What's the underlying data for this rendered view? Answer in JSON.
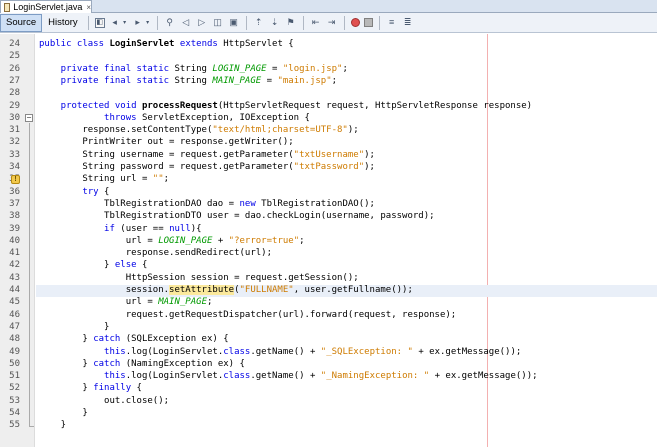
{
  "tab": {
    "filename": "LoginServlet.java",
    "close_glyph": "×"
  },
  "toolbar": {
    "source_label": "Source",
    "history_label": "History"
  },
  "lines": [
    {
      "n": "24",
      "segs": [
        {
          "t": "public class ",
          "c": "kw"
        },
        {
          "t": "LoginServlet ",
          "c": "bold"
        },
        {
          "t": "extends ",
          "c": "kw"
        },
        {
          "t": "HttpServlet {",
          "c": ""
        }
      ]
    },
    {
      "n": "25",
      "segs": []
    },
    {
      "n": "26",
      "segs": [
        {
          "t": "    private final static ",
          "c": "kw"
        },
        {
          "t": "String ",
          "c": ""
        },
        {
          "t": "LOGIN_PAGE",
          "c": "const"
        },
        {
          "t": " = ",
          "c": ""
        },
        {
          "t": "\"login.jsp\"",
          "c": "str"
        },
        {
          "t": ";",
          "c": ""
        }
      ]
    },
    {
      "n": "27",
      "segs": [
        {
          "t": "    private final static ",
          "c": "kw"
        },
        {
          "t": "String ",
          "c": ""
        },
        {
          "t": "MAIN_PAGE",
          "c": "const"
        },
        {
          "t": " = ",
          "c": ""
        },
        {
          "t": "\"main.jsp\"",
          "c": "str"
        },
        {
          "t": ";",
          "c": ""
        }
      ]
    },
    {
      "n": "28",
      "segs": []
    },
    {
      "n": "29",
      "segs": [
        {
          "t": "    protected void ",
          "c": "kw"
        },
        {
          "t": "processRequest",
          "c": "bold"
        },
        {
          "t": "(HttpServletRequest request, HttpServletResponse response)",
          "c": ""
        }
      ]
    },
    {
      "n": "30",
      "segs": [
        {
          "t": "            throws ",
          "c": "kw"
        },
        {
          "t": "ServletException, IOException {",
          "c": ""
        }
      ]
    },
    {
      "n": "31",
      "segs": [
        {
          "t": "        response.setContentType(",
          "c": ""
        },
        {
          "t": "\"text/html;charset=UTF-8\"",
          "c": "str"
        },
        {
          "t": ");",
          "c": ""
        }
      ]
    },
    {
      "n": "32",
      "segs": [
        {
          "t": "        PrintWriter out = response.getWriter();",
          "c": ""
        }
      ]
    },
    {
      "n": "33",
      "segs": [
        {
          "t": "        String username = request.getParameter(",
          "c": ""
        },
        {
          "t": "\"txtUsername\"",
          "c": "str"
        },
        {
          "t": ");",
          "c": ""
        }
      ]
    },
    {
      "n": "34",
      "segs": [
        {
          "t": "        String password = request.getParameter(",
          "c": ""
        },
        {
          "t": "\"txtPassword\"",
          "c": "str"
        },
        {
          "t": ");",
          "c": ""
        }
      ]
    },
    {
      "n": "35",
      "segs": [
        {
          "t": "        String url = ",
          "c": ""
        },
        {
          "t": "\"\"",
          "c": "str"
        },
        {
          "t": ";",
          "c": ""
        }
      ]
    },
    {
      "n": "36",
      "segs": [
        {
          "t": "        try ",
          "c": "kw"
        },
        {
          "t": "{",
          "c": ""
        }
      ]
    },
    {
      "n": "37",
      "segs": [
        {
          "t": "            TblRegistrationDAO dao = ",
          "c": ""
        },
        {
          "t": "new ",
          "c": "kw"
        },
        {
          "t": "TblRegistrationDAO();",
          "c": ""
        }
      ]
    },
    {
      "n": "38",
      "segs": [
        {
          "t": "            TblRegistrationDTO user = dao.checkLogin(username, password);",
          "c": ""
        }
      ]
    },
    {
      "n": "39",
      "segs": [
        {
          "t": "            if ",
          "c": "kw"
        },
        {
          "t": "(user == ",
          "c": ""
        },
        {
          "t": "null",
          "c": "kw"
        },
        {
          "t": "){",
          "c": ""
        }
      ]
    },
    {
      "n": "40",
      "segs": [
        {
          "t": "                url = ",
          "c": ""
        },
        {
          "t": "LOGIN_PAGE",
          "c": "const"
        },
        {
          "t": " + ",
          "c": ""
        },
        {
          "t": "\"?error=true\"",
          "c": "str"
        },
        {
          "t": ";",
          "c": ""
        }
      ]
    },
    {
      "n": "41",
      "segs": [
        {
          "t": "                response.sendRedirect(url);",
          "c": ""
        }
      ]
    },
    {
      "n": "42",
      "segs": [
        {
          "t": "            } ",
          "c": ""
        },
        {
          "t": "else ",
          "c": "kw"
        },
        {
          "t": "{",
          "c": ""
        }
      ]
    },
    {
      "n": "43",
      "segs": [
        {
          "t": "                HttpSession session = request.getSession();",
          "c": ""
        }
      ]
    },
    {
      "n": "44",
      "segs": [
        {
          "t": "                session.",
          "c": ""
        },
        {
          "t": "setAttribute",
          "c": "mark"
        },
        {
          "t": "(",
          "c": ""
        },
        {
          "t": "\"FULLNAME\"",
          "c": "str"
        },
        {
          "t": ", user.getFullname());",
          "c": ""
        }
      ]
    },
    {
      "n": "45",
      "segs": [
        {
          "t": "                url = ",
          "c": ""
        },
        {
          "t": "MAIN_PAGE",
          "c": "const"
        },
        {
          "t": ";",
          "c": ""
        }
      ]
    },
    {
      "n": "46",
      "segs": [
        {
          "t": "                request.getRequestDispatcher(url).forward(request, response);",
          "c": ""
        }
      ]
    },
    {
      "n": "47",
      "segs": [
        {
          "t": "            }",
          "c": ""
        }
      ]
    },
    {
      "n": "48",
      "segs": [
        {
          "t": "        } ",
          "c": ""
        },
        {
          "t": "catch ",
          "c": "kw"
        },
        {
          "t": "(SQLException ex) {",
          "c": ""
        }
      ]
    },
    {
      "n": "49",
      "segs": [
        {
          "t": "            this",
          "c": "kw"
        },
        {
          "t": ".log(LoginServlet.",
          "c": ""
        },
        {
          "t": "class",
          "c": "kw"
        },
        {
          "t": ".getName() + ",
          "c": ""
        },
        {
          "t": "\"_SQLException: \"",
          "c": "str"
        },
        {
          "t": " + ex.getMessage());",
          "c": ""
        }
      ]
    },
    {
      "n": "50",
      "segs": [
        {
          "t": "        } ",
          "c": ""
        },
        {
          "t": "catch ",
          "c": "kw"
        },
        {
          "t": "(NamingException ex) {",
          "c": ""
        }
      ]
    },
    {
      "n": "51",
      "segs": [
        {
          "t": "            this",
          "c": "kw"
        },
        {
          "t": ".log(LoginServlet.",
          "c": ""
        },
        {
          "t": "class",
          "c": "kw"
        },
        {
          "t": ".getName() + ",
          "c": ""
        },
        {
          "t": "\"_NamingException: \"",
          "c": "str"
        },
        {
          "t": " + ex.getMessage());",
          "c": ""
        }
      ]
    },
    {
      "n": "52",
      "segs": [
        {
          "t": "        } ",
          "c": ""
        },
        {
          "t": "finally ",
          "c": "kw"
        },
        {
          "t": "{",
          "c": ""
        }
      ]
    },
    {
      "n": "53",
      "segs": [
        {
          "t": "            out.close();",
          "c": ""
        }
      ]
    },
    {
      "n": "54",
      "segs": [
        {
          "t": "        }",
          "c": ""
        }
      ]
    },
    {
      "n": "55",
      "segs": [
        {
          "t": "    }",
          "c": ""
        }
      ]
    }
  ],
  "highlighted_line": "44",
  "fold_line": "30",
  "warning_line": "35",
  "fold_glyph": "−",
  "warning_glyph": "!"
}
